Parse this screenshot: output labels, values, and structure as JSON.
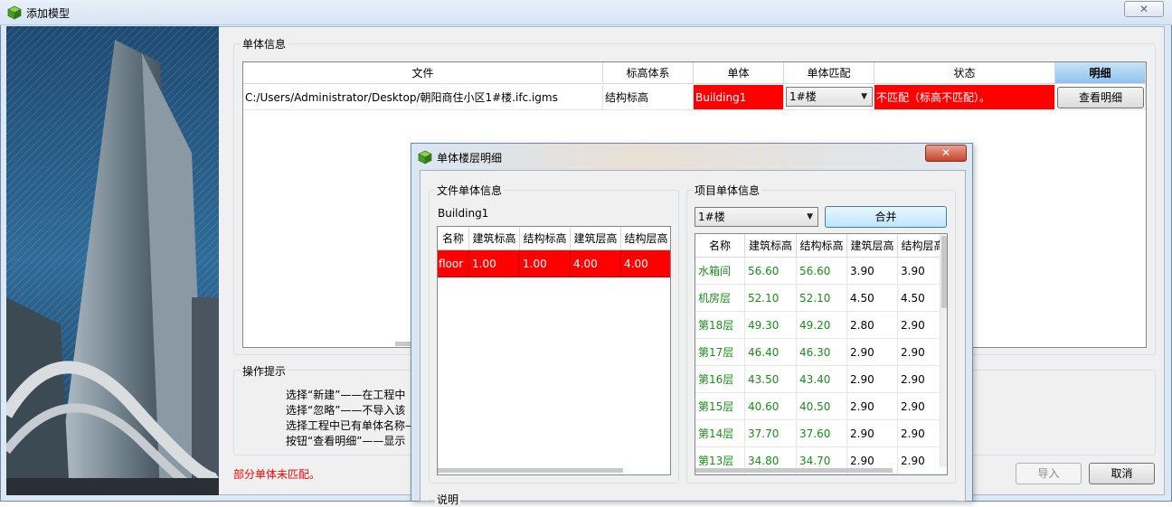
{
  "window": {
    "title": "添加模型",
    "close_glyph": "✕"
  },
  "single_info": {
    "group_label": "单体信息",
    "columns": [
      "文件",
      "标高体系",
      "单体",
      "单体匹配",
      "状态",
      "明细"
    ],
    "row": {
      "file": "C:/Users/Administrator/Desktop/朝阳商住小区1#楼.ifc.igms",
      "elevation_system": "结构标高",
      "building": "Building1",
      "match_value": "1#楼",
      "status": "不匹配（标高不匹配）。",
      "detail_button": "查看明细"
    }
  },
  "hints": {
    "group_label": "操作提示",
    "lines": [
      "选择“新建”——在工程中",
      "选择“忽略”——不导入该",
      "选择工程中已有单体名称—",
      "按钮“查看明细”——显示"
    ]
  },
  "warning": "部分单体未匹配。",
  "buttons": {
    "import": "导入",
    "cancel": "取消"
  },
  "dialog": {
    "title": "单体楼层明细",
    "close_glyph": "✕",
    "file_group": {
      "label": "文件单体信息",
      "building_name": "Building1",
      "columns": [
        "名称",
        "建筑标高",
        "结构标高",
        "建筑层高",
        "结构层高"
      ],
      "rows": [
        [
          "floor",
          "1.00",
          "1.00",
          "4.00",
          "4.00"
        ]
      ]
    },
    "project_group": {
      "label": "项目单体信息",
      "selected_building": "1#楼",
      "merge_button": "合并",
      "columns": [
        "名称",
        "建筑标高",
        "结构标高",
        "建筑层高",
        "结构层高"
      ],
      "rows": [
        [
          "水箱间",
          "56.60",
          "56.60",
          "3.90",
          "3.90"
        ],
        [
          "机房层",
          "52.10",
          "52.10",
          "4.50",
          "4.50"
        ],
        [
          "第18层",
          "49.30",
          "49.20",
          "2.80",
          "2.90"
        ],
        [
          "第17层",
          "46.40",
          "46.30",
          "2.90",
          "2.90"
        ],
        [
          "第16层",
          "43.50",
          "43.40",
          "2.90",
          "2.90"
        ],
        [
          "第15层",
          "40.60",
          "40.50",
          "2.90",
          "2.90"
        ],
        [
          "第14层",
          "37.70",
          "37.60",
          "2.90",
          "2.90"
        ],
        [
          "第13层",
          "34.80",
          "34.70",
          "2.90",
          "2.90"
        ]
      ]
    },
    "note_label": "说明"
  },
  "colors": {
    "mismatch": "#ff0000",
    "matched_text": "#1e8a1e",
    "header_selected": "#8fc3ee"
  },
  "icons": {
    "app": "cube-icon",
    "dropdown": "chevron-down-icon"
  }
}
